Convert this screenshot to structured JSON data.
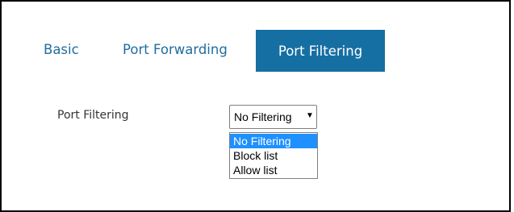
{
  "tabs": {
    "basic": "Basic",
    "port_forwarding": "Port Forwarding",
    "port_filtering": "Port Filtering",
    "active": "port_filtering"
  },
  "form": {
    "port_filtering_label": "Port Filtering",
    "select_value": "No Filtering",
    "options": [
      "No Filtering",
      "Block list",
      "Allow list"
    ],
    "highlighted_option": "No Filtering"
  },
  "colors": {
    "accent": "#166fa2",
    "tab_text": "#1f6e9e",
    "highlight": "#1e90ff"
  },
  "icons": {
    "dropdown_arrow": "caret-down-icon"
  }
}
